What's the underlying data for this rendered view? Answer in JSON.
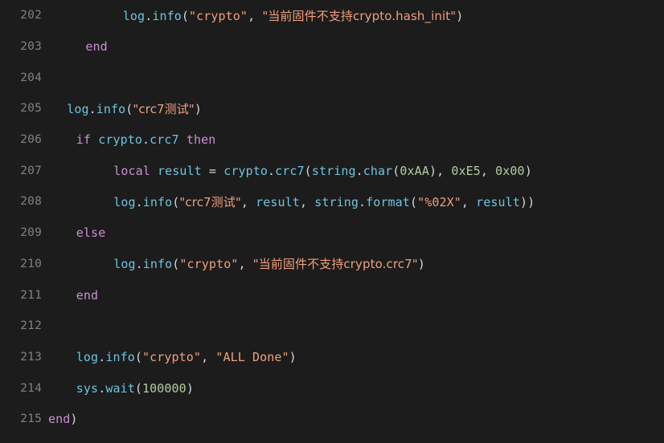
{
  "editor": {
    "background_color": "#1c1c1c",
    "gutter_color": "#818181",
    "colors": {
      "identifier": "#6cc4e0",
      "keyword": "#cb8fd4",
      "string": "#ef9f7d",
      "number": "#b3cca0",
      "punctuation": "#d6d6d6"
    },
    "language": "Lua",
    "first_line_number": 202,
    "last_line_number": 215,
    "lines": [
      {
        "number": "202",
        "indent": 8,
        "text": "log.info(\"crypto\", \"当前固件不支持crypto.hash_init\")",
        "tokens": [
          {
            "t": "log",
            "c": "ident"
          },
          {
            "t": ".",
            "c": "punc"
          },
          {
            "t": "info",
            "c": "ident"
          },
          {
            "t": "(",
            "c": "punc"
          },
          {
            "t": "\"crypto\"",
            "c": "str"
          },
          {
            "t": ", ",
            "c": "punc"
          },
          {
            "t": "\"当前固件不支持crypto.hash_init\"",
            "c": "str"
          },
          {
            "t": ")",
            "c": "punc"
          }
        ]
      },
      {
        "number": "203",
        "indent": 4,
        "text": "end",
        "tokens": [
          {
            "t": "end",
            "c": "kw"
          }
        ]
      },
      {
        "number": "204",
        "indent": 0,
        "text": "",
        "tokens": []
      },
      {
        "number": "205",
        "indent": 2,
        "text": "log.info(\"crc7测试\")",
        "tokens": [
          {
            "t": "log",
            "c": "ident"
          },
          {
            "t": ".",
            "c": "punc"
          },
          {
            "t": "info",
            "c": "ident"
          },
          {
            "t": "(",
            "c": "punc"
          },
          {
            "t": "\"crc7测试\"",
            "c": "str"
          },
          {
            "t": ")",
            "c": "punc"
          }
        ]
      },
      {
        "number": "206",
        "indent": 3,
        "text": "if crypto.crc7 then",
        "tokens": [
          {
            "t": "if",
            "c": "kw"
          },
          {
            "t": " ",
            "c": "punc"
          },
          {
            "t": "crypto",
            "c": "ident"
          },
          {
            "t": ".",
            "c": "punc"
          },
          {
            "t": "crc7",
            "c": "ident"
          },
          {
            "t": " ",
            "c": "punc"
          },
          {
            "t": "then",
            "c": "kw"
          }
        ]
      },
      {
        "number": "207",
        "indent": 7,
        "text": "local result = crypto.crc7(string.char(0xAA), 0xE5, 0x00)",
        "tokens": [
          {
            "t": "local",
            "c": "kw"
          },
          {
            "t": " ",
            "c": "punc"
          },
          {
            "t": "result",
            "c": "ident"
          },
          {
            "t": " ",
            "c": "punc"
          },
          {
            "t": "=",
            "c": "op"
          },
          {
            "t": " ",
            "c": "punc"
          },
          {
            "t": "crypto",
            "c": "ident"
          },
          {
            "t": ".",
            "c": "punc"
          },
          {
            "t": "crc7",
            "c": "ident"
          },
          {
            "t": "(",
            "c": "punc"
          },
          {
            "t": "string",
            "c": "ident"
          },
          {
            "t": ".",
            "c": "punc"
          },
          {
            "t": "char",
            "c": "ident"
          },
          {
            "t": "(",
            "c": "punc"
          },
          {
            "t": "0xAA",
            "c": "num"
          },
          {
            "t": "), ",
            "c": "punc"
          },
          {
            "t": "0xE5",
            "c": "num"
          },
          {
            "t": ", ",
            "c": "punc"
          },
          {
            "t": "0x00",
            "c": "num"
          },
          {
            "t": ")",
            "c": "punc"
          }
        ]
      },
      {
        "number": "208",
        "indent": 7,
        "text": "log.info(\"crc7测试\", result, string.format(\"%02X\", result))",
        "tokens": [
          {
            "t": "log",
            "c": "ident"
          },
          {
            "t": ".",
            "c": "punc"
          },
          {
            "t": "info",
            "c": "ident"
          },
          {
            "t": "(",
            "c": "punc"
          },
          {
            "t": "\"crc7测试\"",
            "c": "str"
          },
          {
            "t": ", ",
            "c": "punc"
          },
          {
            "t": "result",
            "c": "ident"
          },
          {
            "t": ", ",
            "c": "punc"
          },
          {
            "t": "string",
            "c": "ident"
          },
          {
            "t": ".",
            "c": "punc"
          },
          {
            "t": "format",
            "c": "ident"
          },
          {
            "t": "(",
            "c": "punc"
          },
          {
            "t": "\"%02X\"",
            "c": "str"
          },
          {
            "t": ", ",
            "c": "punc"
          },
          {
            "t": "result",
            "c": "ident"
          },
          {
            "t": "))",
            "c": "punc"
          }
        ]
      },
      {
        "number": "209",
        "indent": 3,
        "text": "else",
        "tokens": [
          {
            "t": "else",
            "c": "kw"
          }
        ]
      },
      {
        "number": "210",
        "indent": 7,
        "text": "log.info(\"crypto\", \"当前固件不支持crypto.crc7\")",
        "tokens": [
          {
            "t": "log",
            "c": "ident"
          },
          {
            "t": ".",
            "c": "punc"
          },
          {
            "t": "info",
            "c": "ident"
          },
          {
            "t": "(",
            "c": "punc"
          },
          {
            "t": "\"crypto\"",
            "c": "str"
          },
          {
            "t": ", ",
            "c": "punc"
          },
          {
            "t": "\"当前固件不支持crypto.crc7\"",
            "c": "str"
          },
          {
            "t": ")",
            "c": "punc"
          }
        ]
      },
      {
        "number": "211",
        "indent": 3,
        "text": "end",
        "tokens": [
          {
            "t": "end",
            "c": "kw"
          }
        ]
      },
      {
        "number": "212",
        "indent": 0,
        "text": "",
        "tokens": []
      },
      {
        "number": "213",
        "indent": 3,
        "text": "log.info(\"crypto\", \"ALL Done\")",
        "tokens": [
          {
            "t": "log",
            "c": "ident"
          },
          {
            "t": ".",
            "c": "punc"
          },
          {
            "t": "info",
            "c": "ident"
          },
          {
            "t": "(",
            "c": "punc"
          },
          {
            "t": "\"crypto\"",
            "c": "str"
          },
          {
            "t": ", ",
            "c": "punc"
          },
          {
            "t": "\"ALL Done\"",
            "c": "str"
          },
          {
            "t": ")",
            "c": "punc"
          }
        ]
      },
      {
        "number": "214",
        "indent": 3,
        "text": "sys.wait(100000)",
        "tokens": [
          {
            "t": "sys",
            "c": "ident"
          },
          {
            "t": ".",
            "c": "punc"
          },
          {
            "t": "wait",
            "c": "ident"
          },
          {
            "t": "(",
            "c": "punc"
          },
          {
            "t": "100000",
            "c": "num"
          },
          {
            "t": ")",
            "c": "punc"
          }
        ]
      },
      {
        "number": "215",
        "indent": 0,
        "text": "end)",
        "tokens": [
          {
            "t": "end",
            "c": "kw"
          },
          {
            "t": ")",
            "c": "punc"
          }
        ]
      }
    ]
  }
}
